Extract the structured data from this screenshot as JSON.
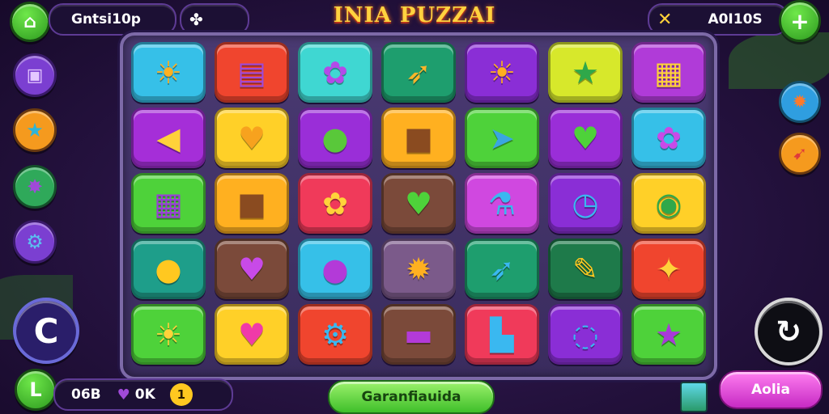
{
  "header": {
    "title": "INIA PUZZAI",
    "player_name": "Gntsi10p",
    "right_counter": "A0I10S",
    "left_icon": "home-icon",
    "clover_icon": "clover-icon",
    "cross_icon": "crossed-swords-icon",
    "add_icon": "plus-icon"
  },
  "left_sidebar": [
    {
      "icon": "bag-icon",
      "color": "#7b3fd1"
    },
    {
      "icon": "star-icon",
      "color": "#f59a1e"
    },
    {
      "icon": "monster-icon",
      "color": "#2fa95a"
    },
    {
      "icon": "gear-icon",
      "color": "#7b3fd1"
    }
  ],
  "right_sidebar": [
    {
      "icon": "gear-icon",
      "color": "#2f9ee0"
    },
    {
      "icon": "rocket-icon",
      "color": "#f59a1e"
    }
  ],
  "board": {
    "rows": [
      [
        {
          "icon": "sun-icon",
          "glyph": "☀",
          "bg": "#36c0e8",
          "fg": "#ffb020"
        },
        {
          "icon": "book-icon",
          "glyph": "▤",
          "bg": "#f0452e",
          "fg": "#a04ad8"
        },
        {
          "icon": "flower-icon",
          "glyph": "✿",
          "bg": "#3fd7d2",
          "fg": "#b34ae8"
        },
        {
          "icon": "arrow-icon",
          "glyph": "➶",
          "bg": "#1e9e6e",
          "fg": "#f8b52a"
        },
        {
          "icon": "sun-icon",
          "glyph": "☀",
          "bg": "#8a2ed6",
          "fg": "#ffb020"
        },
        {
          "icon": "star-icon",
          "glyph": "★",
          "bg": "#d7e82b",
          "fg": "#2fa84a"
        },
        {
          "icon": "radio-icon",
          "glyph": "▦",
          "bg": "#b03bd8",
          "fg": "#ffd23a"
        }
      ],
      [
        {
          "icon": "horn-icon",
          "glyph": "◀",
          "bg": "#a52ed8",
          "fg": "#ffd23a"
        },
        {
          "icon": "heart-icon",
          "glyph": "♥",
          "bg": "#ffd028",
          "fg": "#f7a21e"
        },
        {
          "icon": "balloon-icon",
          "glyph": "●",
          "bg": "#9a2ed8",
          "fg": "#59c83a"
        },
        {
          "icon": "box-icon",
          "glyph": "■",
          "bg": "#ffb020",
          "fg": "#8a4b20"
        },
        {
          "icon": "arrow-icon",
          "glyph": "➤",
          "bg": "#4ed23a",
          "fg": "#3aa6e0"
        },
        {
          "icon": "heart-icon",
          "glyph": "♥",
          "bg": "#9a2ed8",
          "fg": "#4ed23a"
        },
        {
          "icon": "flower-icon",
          "glyph": "✿",
          "bg": "#36c0e8",
          "fg": "#c84ae8"
        }
      ],
      [
        {
          "icon": "radio-icon",
          "glyph": "▦",
          "bg": "#4ed23a",
          "fg": "#9a3ed8"
        },
        {
          "icon": "box-icon",
          "glyph": "■",
          "bg": "#ffb020",
          "fg": "#8a4b20"
        },
        {
          "icon": "flower-icon",
          "glyph": "✿",
          "bg": "#f03a5a",
          "fg": "#ffd23a"
        },
        {
          "icon": "heart-icon",
          "glyph": "♥",
          "bg": "#7b4a3a",
          "fg": "#4ed23a"
        },
        {
          "icon": "potion-icon",
          "glyph": "⚗",
          "bg": "#d048e0",
          "fg": "#3ab8f0"
        },
        {
          "icon": "clock-icon",
          "glyph": "◷",
          "bg": "#8a2ed6",
          "fg": "#3ab8f0"
        },
        {
          "icon": "wreath-icon",
          "glyph": "◉",
          "bg": "#ffd028",
          "fg": "#2fa84a"
        }
      ],
      [
        {
          "icon": "lollipop-icon",
          "glyph": "●",
          "bg": "#1e9e8a",
          "fg": "#ffc820"
        },
        {
          "icon": "heart-icon",
          "glyph": "♥",
          "bg": "#7b4a3a",
          "fg": "#c84ae8"
        },
        {
          "icon": "bomb-icon",
          "glyph": "●",
          "bg": "#36c0e8",
          "fg": "#b33ad8"
        },
        {
          "icon": "gear-icon",
          "glyph": "✹",
          "bg": "#7b5a8a",
          "fg": "#ffb020"
        },
        {
          "icon": "arrow-icon",
          "glyph": "➶",
          "bg": "#1e9e6e",
          "fg": "#3ab8f0"
        },
        {
          "icon": "pencil-icon",
          "glyph": "✎",
          "bg": "#1e7a4a",
          "fg": "#ffc820"
        },
        {
          "icon": "star-icon",
          "glyph": "✦",
          "bg": "#f0452e",
          "fg": "#ffd23a"
        }
      ],
      [
        {
          "icon": "sun-icon",
          "glyph": "☀",
          "bg": "#4ed23a",
          "fg": "#ffd23a"
        },
        {
          "icon": "heart-icon",
          "glyph": "♥",
          "bg": "#ffd028",
          "fg": "#f03aa8"
        },
        {
          "icon": "gear-icon",
          "glyph": "⚙",
          "bg": "#f0452e",
          "fg": "#3ab8f0"
        },
        {
          "icon": "cup-icon",
          "glyph": "▬",
          "bg": "#7b4a3a",
          "fg": "#b33ad8"
        },
        {
          "icon": "scroll-icon",
          "glyph": "▙",
          "bg": "#f03a5a",
          "fg": "#3ab8f0"
        },
        {
          "icon": "swirl-icon",
          "glyph": "◌",
          "bg": "#8a2ed6",
          "fg": "#3ab8f0"
        },
        {
          "icon": "star-icon",
          "glyph": "★",
          "bg": "#4ed23a",
          "fg": "#a83ad8"
        }
      ]
    ]
  },
  "footer": {
    "coins": "06B",
    "gems": "0K",
    "token_label": "1",
    "main_button": "Garanfiauida",
    "right_button": "Aolia",
    "trash_icon": "trash-icon"
  },
  "side_buttons": {
    "refresh_icon": "refresh-icon",
    "back_icon": "undo-icon",
    "settings_icon": "clock-icon"
  }
}
